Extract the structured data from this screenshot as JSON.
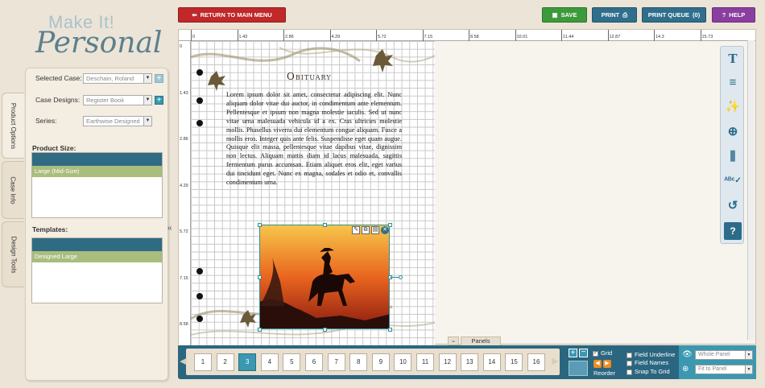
{
  "app": {
    "logo_line1": "Make It!",
    "logo_line2": "Personal"
  },
  "vertical_tabs": [
    "Product Options",
    "Case Info",
    "Design Tools"
  ],
  "left_panel": {
    "selected_case_label": "Selected Case:",
    "selected_case_value": "Deschain, Roland",
    "case_designs_label": "Case Designs:",
    "case_designs_value": "Register Book",
    "series_label": "Series:",
    "series_value": "Earthwise Designed",
    "product_size_label": "Product Size:",
    "product_size_selected": "Large (Mid-Size)",
    "templates_label": "Templates:",
    "templates_selected": "Designed Large"
  },
  "toolbar": {
    "return_label": "RETURN TO MAIN MENU",
    "save_label": "SAVE",
    "print_label": "PRINT",
    "print_queue_label": "PRINT QUEUE",
    "print_queue_count": "(0)",
    "help_label": "HELP"
  },
  "ruler": {
    "h_ticks": [
      "0",
      "1.43",
      "2.86",
      "4.29",
      "5.72",
      "7.15",
      "8.58",
      "10.01",
      "11.44",
      "12.87",
      "14.3",
      "15.73"
    ],
    "v_ticks": [
      "0",
      "1.43",
      "2.86",
      "4.29",
      "5.72",
      "7.15",
      "8.58"
    ]
  },
  "document": {
    "title": "Obituary",
    "body": "Lorem ipsum dolor sit amet, consectetur adipiscing elit. Nunc aliquam dolor vitae dui auctor, in condimentum ante elementum. Pellentesque et ipsum non magna molestie iaculis. Sed ut nunc vitae urna malesuada vehicula id a ex. Cras ultricies molestie mollis. Phasellus viverra dui elementum congue aliquam. Fusce a mollis eros. Integer quis ante felis. Suspendisse eget quam augue. Quisque elit massa, pellentesque vitae dapibus vitae, dignissim non lectus. Aliquam mattis diam id lacus malesuada, sagittis fermentum purus accumsan. Etiam aliquet eros elit, eget varius dui tincidunt eget. Nunc ex magna, sodales et odio et, convallis condimentum urna."
  },
  "panels_label": "Panels",
  "bottom": {
    "pages": [
      "1",
      "2",
      "3",
      "4",
      "5",
      "6",
      "7",
      "8",
      "9",
      "10",
      "11",
      "12",
      "13",
      "14",
      "15",
      "16"
    ],
    "active_page": "3",
    "grid_label": "Grid",
    "reorder_label": "Reorder",
    "field_underline_label": "Field Underline",
    "field_names_label": "Field Names",
    "snap_label": "Snap To Grid",
    "view_value": "Whole Panel",
    "zoom_value": "Fit to Panel"
  },
  "colors": {
    "accent": "#3a98b0",
    "bar": "#2b6680",
    "save": "#3c9a3a",
    "return": "#c0282a",
    "help": "#8a3fa0"
  }
}
